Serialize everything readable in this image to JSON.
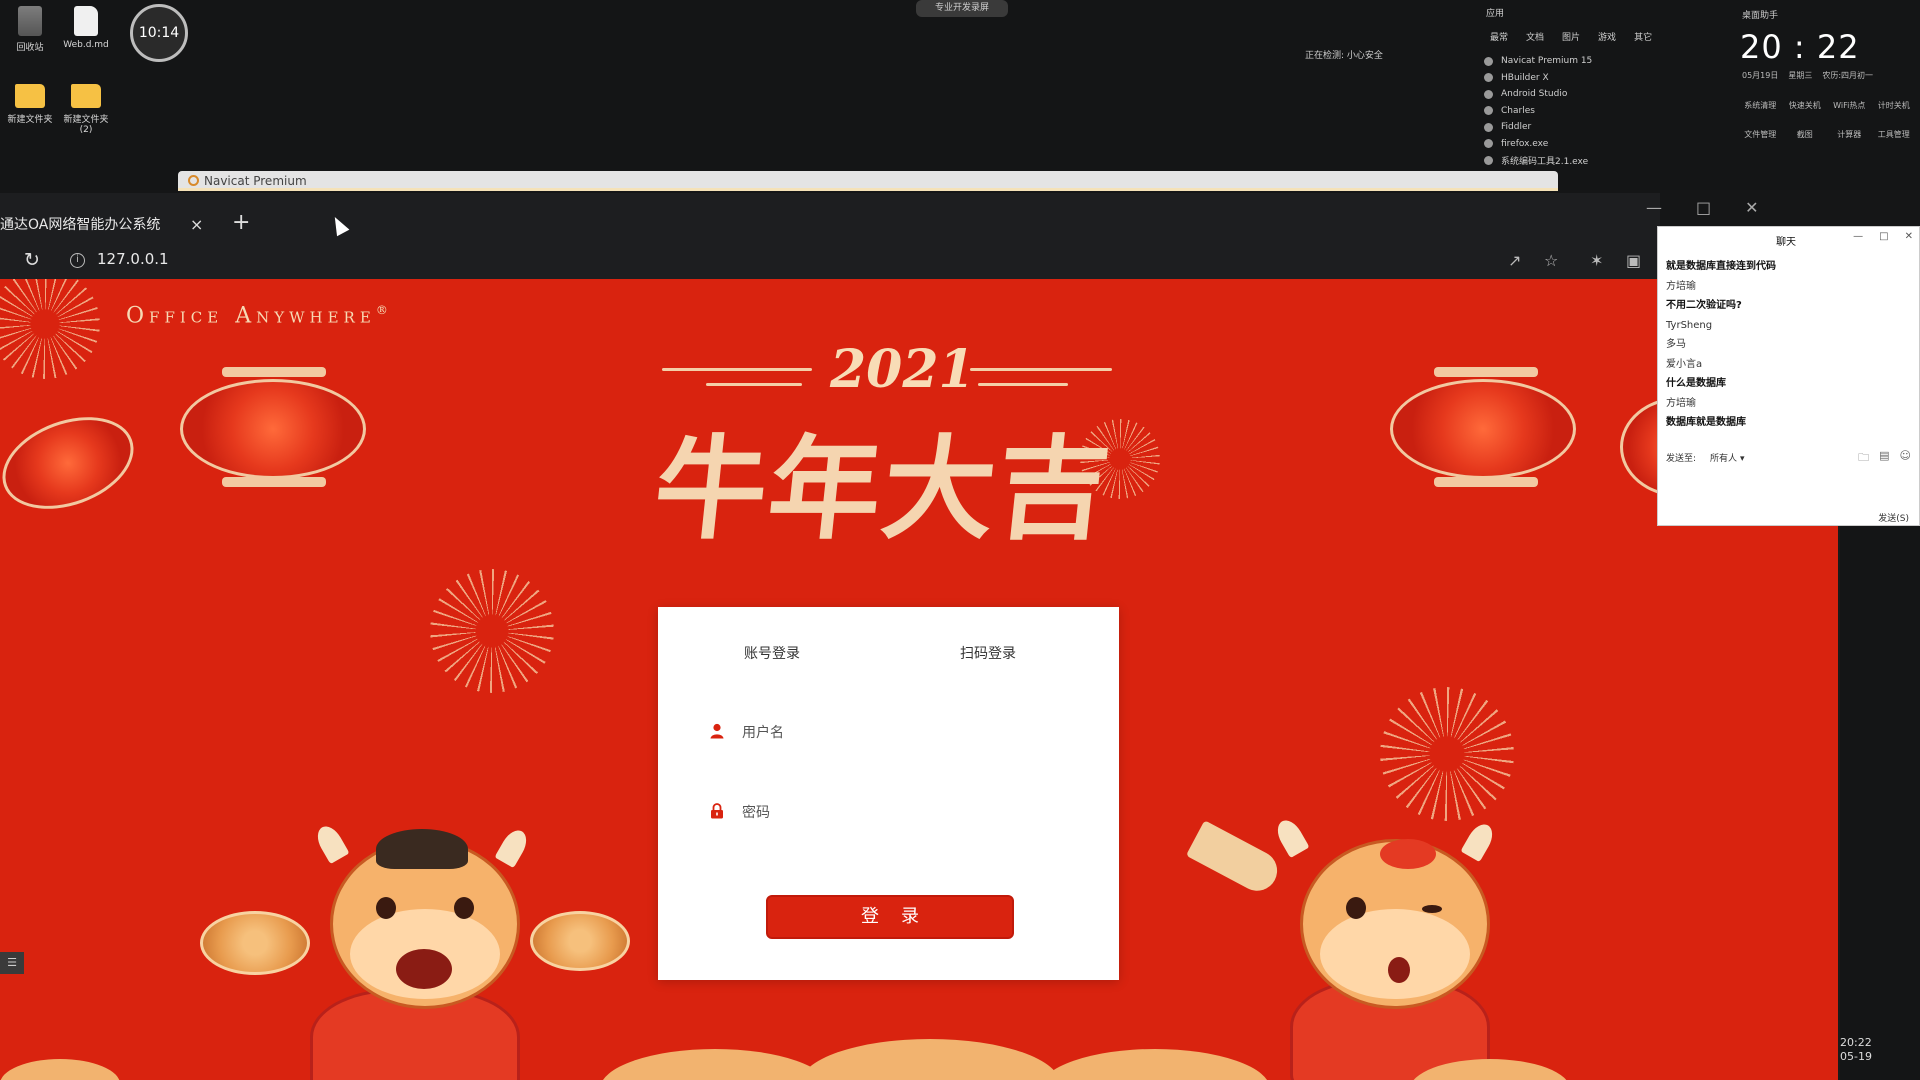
{
  "desktop": {
    "icons": [
      {
        "label": "回收站",
        "type": "bin"
      },
      {
        "label": "Web.d.md",
        "type": "doc"
      },
      {
        "label": "新建文件夹",
        "type": "folder"
      },
      {
        "label": "新建文件夹\n(2)",
        "type": "folder"
      }
    ],
    "clock_circle": "10:14",
    "top_badge": "专业开发录屏",
    "status_text": "正在检测: 小心安全"
  },
  "launcher": {
    "header": "应用",
    "tabs": [
      "最常",
      "文档",
      "图片",
      "游戏",
      "其它"
    ],
    "apps": [
      "Navicat Premium 15",
      "HBuilder X",
      "Android Studio",
      "Charles",
      "Fiddler",
      "firefox.exe",
      "系统编码工具2.1.exe"
    ]
  },
  "date_widget": {
    "title": "桌面助手",
    "time": "20 : 22",
    "date": [
      "05月19日",
      "星期三",
      "农历:四月初一"
    ],
    "shortcuts": [
      "系统清理",
      "快速关机",
      "WiFi热点",
      "计时关机",
      "文件管理",
      "截图",
      "计算器",
      "工具管理"
    ]
  },
  "navicat": {
    "title": "Navicat Premium"
  },
  "browser": {
    "tab_title": "通达OA网络智能办公系统",
    "tab_close": "×",
    "new_tab": "+",
    "url": "127.0.0.1"
  },
  "page": {
    "brand": "Office Anywhere",
    "brand_mark": "®",
    "year": "2021",
    "slogan": "牛年大吉"
  },
  "login": {
    "tab_account": "账号登录",
    "tab_qr": "扫码登录",
    "username_placeholder": "用户名",
    "password_placeholder": "密码",
    "submit": "登录"
  },
  "chat": {
    "title": "聊天",
    "messages": [
      {
        "text": "就是数据库直接连到代码",
        "bold": true
      },
      {
        "text": "方培瑜",
        "bold": false
      },
      {
        "text": "不用二次验证吗?",
        "bold": true
      },
      {
        "text": "TyrSheng",
        "bold": false
      },
      {
        "text": "多马",
        "bold": false
      },
      {
        "text": "爱小言a",
        "bold": false
      },
      {
        "text": "什么是数据库",
        "bold": true
      },
      {
        "text": "方培瑜",
        "bold": false
      },
      {
        "text": "数据库就是数据库",
        "bold": true
      }
    ],
    "send_to_label": "发送至:",
    "send_to_value": "所有人",
    "send_button": "发送(S)"
  },
  "taskbar": {
    "corner_time": "20:22",
    "corner_date": "05-19"
  },
  "colors": {
    "page_red": "#d9230f",
    "accent_gold": "#f5d5b0",
    "login_button": "#d9230f"
  }
}
